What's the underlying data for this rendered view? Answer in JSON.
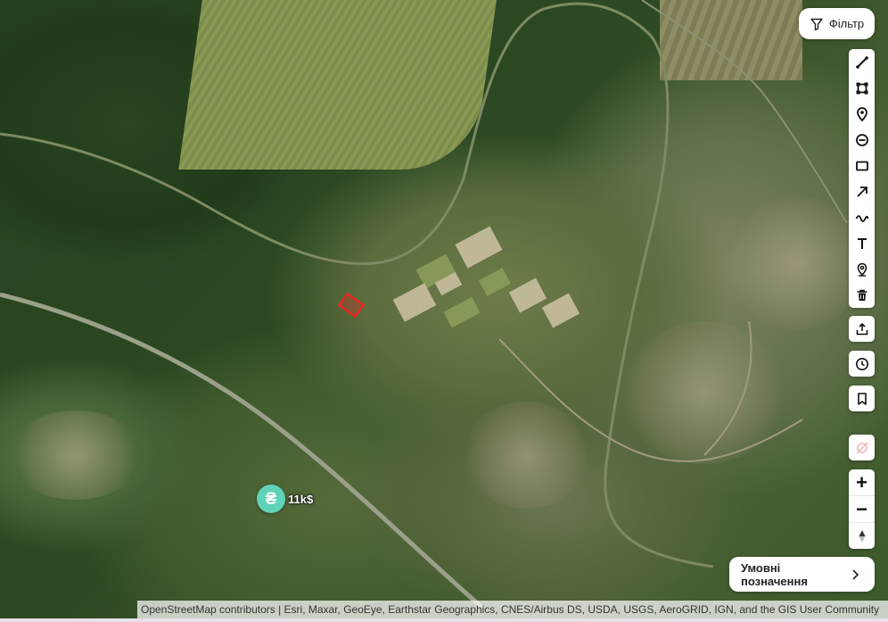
{
  "filter": {
    "label": "Фільтр",
    "icon": "filter-icon"
  },
  "toolbar": {
    "tools": [
      {
        "name": "line-draw-icon"
      },
      {
        "name": "polygon-draw-icon"
      },
      {
        "name": "pin-icon"
      },
      {
        "name": "circle-draw-icon"
      },
      {
        "name": "rectangle-draw-icon"
      },
      {
        "name": "arrow-draw-icon"
      },
      {
        "name": "freehand-draw-icon"
      },
      {
        "name": "text-tool-icon"
      },
      {
        "name": "place-marker-icon"
      },
      {
        "name": "delete-icon"
      }
    ],
    "share_icon": "share-icon",
    "history_icon": "history-icon",
    "bookmark_icon": "bookmark-icon",
    "geolocation_icon": "geolocation-disabled-icon"
  },
  "zoom": {
    "in": "+",
    "out": "−",
    "compass_icon": "compass-icon"
  },
  "price_marker": {
    "symbol": "₴",
    "label": "11k$",
    "color": "#5fd3b7"
  },
  "parcel": {
    "color": "#ff1e1e"
  },
  "legend": {
    "label": "Умовні позначення",
    "icon": "chevron-right-icon"
  },
  "attribution": "OpenStreetMap contributors | Esri, Maxar, GeoEye, Earthstar Geographics, CNES/Airbus DS, USDA, USGS, AeroGRID, IGN, and the GIS User Community"
}
